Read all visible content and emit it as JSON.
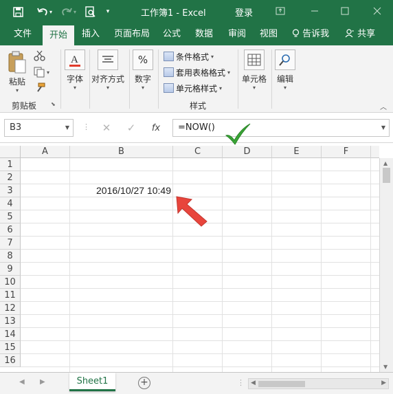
{
  "window": {
    "title": "工作簿1  -  Excel",
    "login_label": "登录"
  },
  "tabs": [
    {
      "label": "文件"
    },
    {
      "label": "开始"
    },
    {
      "label": "插入"
    },
    {
      "label": "页面布局"
    },
    {
      "label": "公式"
    },
    {
      "label": "数据"
    },
    {
      "label": "审阅"
    },
    {
      "label": "视图"
    },
    {
      "label": "告诉我"
    },
    {
      "label": "共享"
    }
  ],
  "ribbon": {
    "clipboard": {
      "paste_label": "粘贴",
      "group_label": "剪贴板"
    },
    "font": {
      "label": "字体"
    },
    "alignment": {
      "label": "对齐方式"
    },
    "number": {
      "label": "数字"
    },
    "styles": {
      "items": [
        "条件格式",
        "套用表格格式",
        "单元格样式"
      ],
      "group_label": "样式"
    },
    "cells": {
      "label": "单元格"
    },
    "editing": {
      "label": "编辑"
    }
  },
  "formula_bar": {
    "name_box": "B3",
    "fx_label": "fx",
    "formula": "=NOW()"
  },
  "grid": {
    "columns": [
      "A",
      "B",
      "C",
      "D",
      "E",
      "F"
    ],
    "rows": [
      "1",
      "2",
      "3",
      "4",
      "5",
      "6",
      "7",
      "8",
      "9",
      "10",
      "11",
      "12",
      "13",
      "14",
      "15",
      "16"
    ],
    "cell_b3": "2016/10/27 10:49"
  },
  "sheets": {
    "tab_label": "Sheet1"
  },
  "colors": {
    "brand": "#217346",
    "annotation_arrow": "#e8453c",
    "annotation_check": "#3aa537"
  }
}
